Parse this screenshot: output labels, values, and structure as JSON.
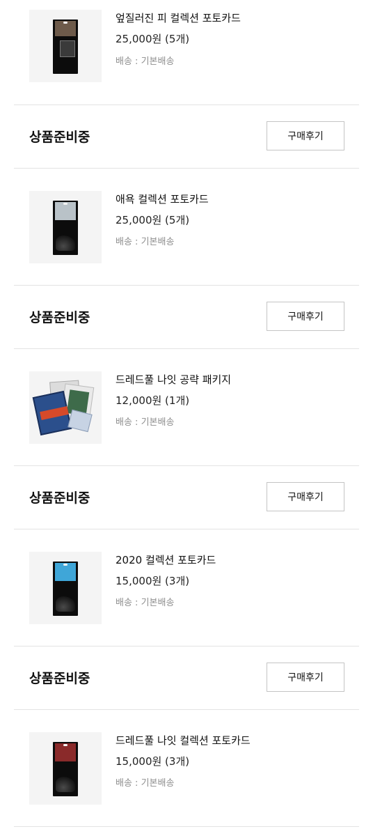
{
  "orders": [
    {
      "name": "엎질러진 피 컬렉션 포토카드",
      "price": "25,000원 (5개)",
      "shipping": "배송 : 기본배송",
      "status": "상품준비중",
      "review_label": "구매후기",
      "thumb_icon": "photocard-pack-icon",
      "card_color": "#6d5a4a"
    },
    {
      "name": "애욕 컬렉션 포토카드",
      "price": "25,000원 (5개)",
      "shipping": "배송 : 기본배송",
      "status": "상품준비중",
      "review_label": "구매후기",
      "thumb_icon": "photocard-pack-icon",
      "card_color": "#b9c2c8"
    },
    {
      "name": "드레드풀 나잇 공략 패키지",
      "price": "12,000원 (1개)",
      "shipping": "배송 : 기본배송",
      "status": "상품준비중",
      "review_label": "구매후기",
      "thumb_icon": "package-bundle-icon",
      "card_color": "#2b4f8c"
    },
    {
      "name": "2020 컬렉션 포토카드",
      "price": "15,000원 (3개)",
      "shipping": "배송 : 기본배송",
      "status": "상품준비중",
      "review_label": "구매후기",
      "thumb_icon": "photocard-pack-icon",
      "card_color": "#3fa6d8"
    },
    {
      "name": "드레드풀 나잇 컬렉션 포토카드",
      "price": "15,000원 (3개)",
      "shipping": "배송 : 기본배송",
      "thumb_icon": "photocard-pack-icon",
      "card_color": "#8a2a2a"
    }
  ],
  "colors": {
    "divider": "#e3e3e3",
    "thumb_bg": "#f4f4f4",
    "muted_text": "#8e8e8e",
    "button_border": "#c4c4c4"
  }
}
